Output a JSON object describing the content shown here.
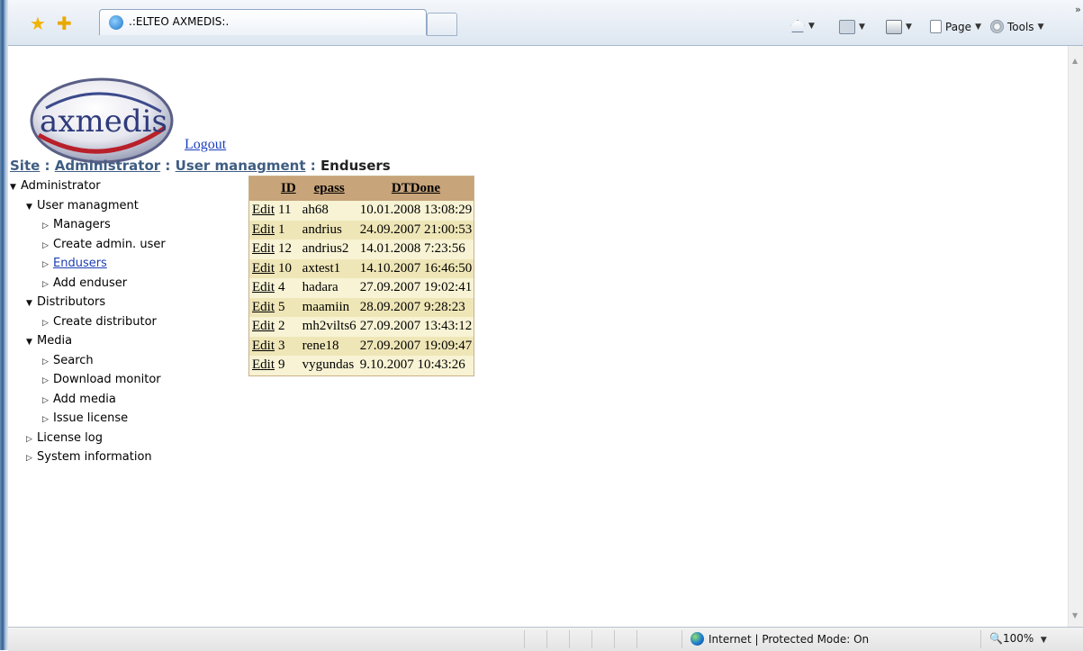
{
  "browser": {
    "tab_title": ".:ELTEO AXMEDIS:.",
    "commands": {
      "page": "Page",
      "tools": "Tools"
    }
  },
  "page": {
    "logo_text": "axmedis",
    "logout": "Logout",
    "breadcrumb": {
      "site": "Site",
      "administrator": "Administrator",
      "user_managment": "User managment",
      "current": "Endusers",
      "sep": " : "
    }
  },
  "tree": {
    "items": [
      {
        "label": "Administrator",
        "expanded": true
      },
      {
        "label": "User managment",
        "expanded": true
      },
      {
        "label": "Managers"
      },
      {
        "label": "Create admin. user"
      },
      {
        "label": "Endusers",
        "active": true
      },
      {
        "label": "Add enduser"
      },
      {
        "label": "Distributors",
        "expanded": true
      },
      {
        "label": "Create distributor"
      },
      {
        "label": "Media",
        "expanded": true
      },
      {
        "label": "Search"
      },
      {
        "label": "Download monitor"
      },
      {
        "label": "Add media"
      },
      {
        "label": "Issue license"
      },
      {
        "label": "License log"
      },
      {
        "label": "System information"
      }
    ]
  },
  "table": {
    "headers": [
      "ID",
      "epass",
      "DTDone"
    ],
    "edit_label": "Edit",
    "rows": [
      {
        "id": "11",
        "epass": "ah68",
        "dtdone": "10.01.2008 13:08:29"
      },
      {
        "id": "1",
        "epass": "andrius",
        "dtdone": "24.09.2007 21:00:53"
      },
      {
        "id": "12",
        "epass": "andrius2",
        "dtdone": "14.01.2008 7:23:56"
      },
      {
        "id": "10",
        "epass": "axtest1",
        "dtdone": "14.10.2007 16:46:50"
      },
      {
        "id": "4",
        "epass": "hadara",
        "dtdone": "27.09.2007 19:02:41"
      },
      {
        "id": "5",
        "epass": "maamiin",
        "dtdone": "28.09.2007 9:28:23"
      },
      {
        "id": "2",
        "epass": "mh2vilts6",
        "dtdone": "27.09.2007 13:43:12"
      },
      {
        "id": "3",
        "epass": "rene18",
        "dtdone": "27.09.2007 19:09:47"
      },
      {
        "id": "9",
        "epass": "vygundas",
        "dtdone": "9.10.2007 10:43:26"
      }
    ]
  },
  "status": {
    "zone": "Internet | Protected Mode: On",
    "zoom": "100%"
  }
}
